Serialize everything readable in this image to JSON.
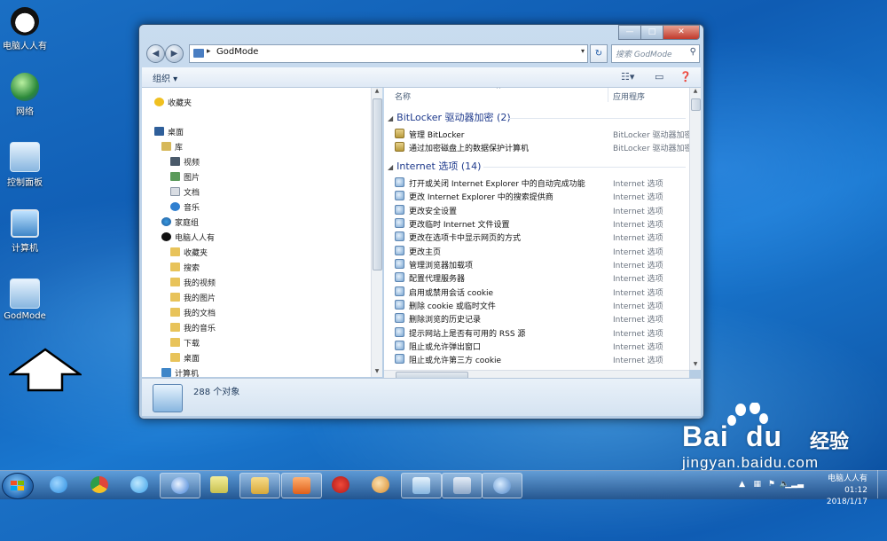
{
  "desktop": {
    "icons": [
      {
        "label": "电脑人人有",
        "icon": "panda-icon"
      },
      {
        "label": "网络",
        "icon": "network-globe-icon"
      },
      {
        "label": "控制面板",
        "icon": "control-panel-icon"
      },
      {
        "label": "计算机",
        "icon": "computer-icon"
      },
      {
        "label": "GodMode",
        "icon": "godmode-icon"
      }
    ]
  },
  "window": {
    "address": {
      "path": "GodMode"
    },
    "search": {
      "placeholder": "搜索 GodMode"
    },
    "toolbar": {
      "organize": "组织 ▾"
    },
    "nav": {
      "items": [
        {
          "label": "收藏夹",
          "indent": 0
        },
        {
          "label": "桌面",
          "indent": 0
        },
        {
          "label": "库",
          "indent": 1
        },
        {
          "label": "视频",
          "indent": 2
        },
        {
          "label": "图片",
          "indent": 2
        },
        {
          "label": "文档",
          "indent": 2
        },
        {
          "label": "音乐",
          "indent": 2
        },
        {
          "label": "家庭组",
          "indent": 1
        },
        {
          "label": "电脑人人有",
          "indent": 1
        },
        {
          "label": "收藏夹",
          "indent": 2
        },
        {
          "label": "搜索",
          "indent": 2
        },
        {
          "label": "我的视频",
          "indent": 2
        },
        {
          "label": "我的图片",
          "indent": 2
        },
        {
          "label": "我的文档",
          "indent": 2
        },
        {
          "label": "我的音乐",
          "indent": 2
        },
        {
          "label": "下载",
          "indent": 2
        },
        {
          "label": "桌面",
          "indent": 2
        },
        {
          "label": "计算机",
          "indent": 1
        }
      ]
    },
    "columns": {
      "name": "名称",
      "app": "应用程序"
    },
    "groups": [
      {
        "title": "BitLocker 驱动器加密 (2)",
        "items": [
          {
            "name": "管理 BitLocker",
            "app": "BitLocker 驱动器加密"
          },
          {
            "name": "通过加密磁盘上的数据保护计算机",
            "app": "BitLocker 驱动器加密"
          }
        ]
      },
      {
        "title": "Internet 选项 (14)",
        "items": [
          {
            "name": "打开或关闭 Internet Explorer 中的自动完成功能",
            "app": "Internet 选项"
          },
          {
            "name": "更改 Internet Explorer 中的搜索提供商",
            "app": "Internet 选项"
          },
          {
            "name": "更改安全设置",
            "app": "Internet 选项"
          },
          {
            "name": "更改临时 Internet 文件设置",
            "app": "Internet 选项"
          },
          {
            "name": "更改在选项卡中显示网页的方式",
            "app": "Internet 选项"
          },
          {
            "name": "更改主页",
            "app": "Internet 选项"
          },
          {
            "name": "管理浏览器加载项",
            "app": "Internet 选项"
          },
          {
            "name": "配置代理服务器",
            "app": "Internet 选项"
          },
          {
            "name": "启用或禁用会话 cookie",
            "app": "Internet 选项"
          },
          {
            "name": "删除 cookie 或临时文件",
            "app": "Internet 选项"
          },
          {
            "name": "删除浏览的历史记录",
            "app": "Internet 选项"
          },
          {
            "name": "提示网站上是否有可用的 RSS 源",
            "app": "Internet 选项"
          },
          {
            "name": "阻止或允许弹出窗口",
            "app": "Internet 选项"
          },
          {
            "name": "阻止或允许第三方 cookie",
            "app": "Internet 选项"
          }
        ]
      }
    ],
    "status": {
      "text": "288 个对象"
    }
  },
  "taskbar": {
    "buttons": [
      {
        "name": "internet-explorer-icon",
        "color": "#2a8de0"
      },
      {
        "name": "chrome-icon",
        "color": "#e0463a"
      },
      {
        "name": "edge-cloud-icon",
        "color": "#3aa0e8"
      },
      {
        "name": "sogou-icon",
        "color": "#3e7fd6"
      },
      {
        "name": "sticky-notes-icon",
        "color": "#d8d36a"
      },
      {
        "name": "file-explorer-icon",
        "color": "#e8c35a"
      },
      {
        "name": "media-player-icon",
        "color": "#e87a2a"
      },
      {
        "name": "chinese-chess-icon",
        "color": "#d82a2a"
      },
      {
        "name": "paint-icon",
        "color": "#e8a84a"
      },
      {
        "name": "control-panel-icon",
        "color": "#6aaee0"
      },
      {
        "name": "scanner-icon",
        "color": "#9fb7d8"
      },
      {
        "name": "game-icon",
        "color": "#5a8fd0"
      }
    ],
    "tray": {
      "clock_line1": "电脑人人有 01:12",
      "clock_line2": "2018/1/17"
    }
  },
  "watermark": {
    "brand_logo": "Baidu经验",
    "url": "jingyan.baidu.com"
  }
}
